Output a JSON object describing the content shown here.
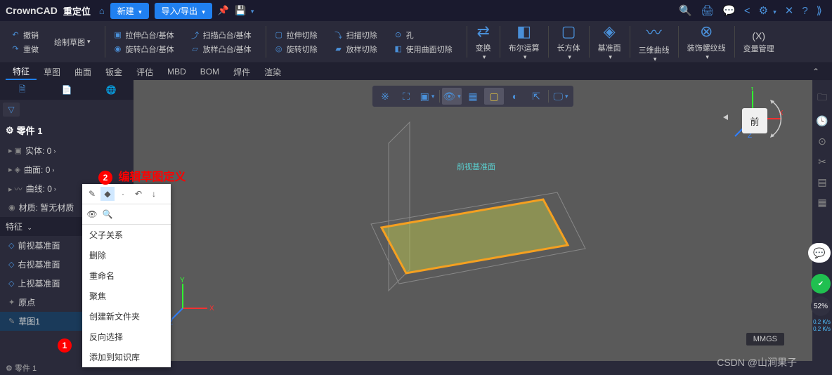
{
  "titlebar": {
    "logo": "CrownCAD",
    "title": "重定位",
    "new_btn": "新建",
    "import_btn": "导入/导出"
  },
  "ribbon": {
    "left": {
      "undo": "撤销",
      "redo": "重做",
      "sketch_drop": "绘制草图"
    },
    "group1": {
      "extrude": "拉伸凸台/基体",
      "revolve": "旋转凸台/基体"
    },
    "group2": {
      "sweep": "扫描凸台/基体",
      "loft": "放样凸台/基体"
    },
    "group3": {
      "extrude_cut": "拉伸切除",
      "revolve_cut": "旋转切除"
    },
    "group4": {
      "sweep_cut": "扫描切除",
      "loft_cut": "放样切除"
    },
    "group5": {
      "hole": "孔",
      "surf_cut": "使用曲面切除"
    },
    "big": {
      "transform": "变换",
      "boolean": "布尔运算",
      "cuboid": "长方体",
      "plane": "基准面",
      "curve3d": "三维曲线",
      "thread": "装饰螺纹线",
      "var": "变量管理",
      "var_x": "(X)"
    }
  },
  "tabs": [
    "特征",
    "草图",
    "曲面",
    "钣金",
    "评估",
    "MBD",
    "BOM",
    "焊件",
    "渲染"
  ],
  "tree": {
    "header": "零件 1",
    "solid": "实体: 0",
    "surface": "曲面: 0",
    "curve": "曲线: 0",
    "material": "材质: 暂无材质",
    "section": "特征",
    "front_plane": "前视基准面",
    "right_plane": "右视基准面",
    "top_plane": "上视基准面",
    "origin": "原点",
    "sketch1": "草图1"
  },
  "context_menu": {
    "items": [
      "父子关系",
      "删除",
      "重命名",
      "聚焦",
      "创建新文件夹",
      "反向选择",
      "添加到知识库"
    ]
  },
  "callouts": {
    "n1": "1",
    "n2": "2",
    "text2": "编辑草图定义"
  },
  "viewport": {
    "plane_label": "前视基准面",
    "axis_x": "X",
    "axis_y": "Y",
    "axis_z": "Z",
    "cube_face": "前"
  },
  "status": {
    "left": "零件 1",
    "units": "MMGS"
  },
  "watermark": "CSDN @山涧果子",
  "float": {
    "pct": "52%",
    "speed1": "0.2 K/s",
    "speed2": "0.2 K/s"
  }
}
